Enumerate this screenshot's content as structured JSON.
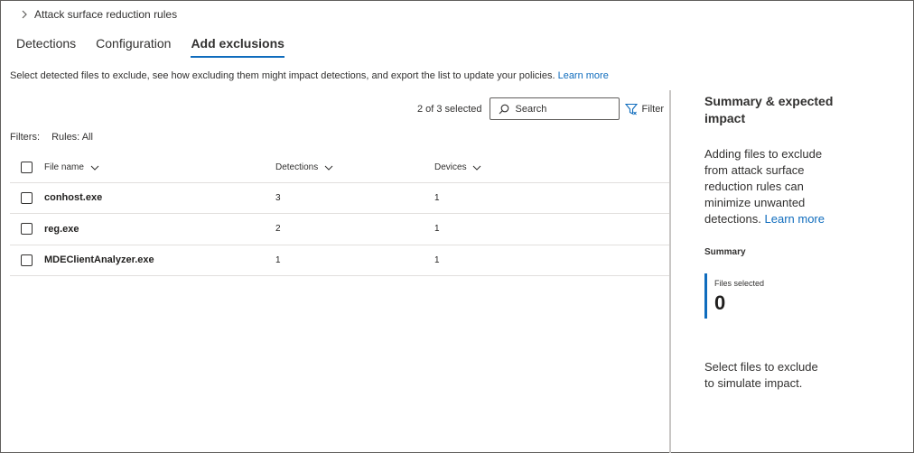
{
  "breadcrumb": {
    "label": "Attack surface reduction rules"
  },
  "tabs": [
    {
      "label": "Detections"
    },
    {
      "label": "Configuration"
    },
    {
      "label": "Add exclusions"
    }
  ],
  "description": {
    "text": "Select detected files to exclude, see how excluding them might impact detections, and export the list to update your policies.",
    "link": "Learn more"
  },
  "toolbar": {
    "selected_count": "2 of 3 selected",
    "search_placeholder": "Search",
    "filter_label": "Filter"
  },
  "filters": {
    "label": "Filters:",
    "value": "Rules: All"
  },
  "table": {
    "columns": [
      "File name",
      "Detections",
      "Devices"
    ],
    "rows": [
      {
        "name": "conhost.exe",
        "detections": "3",
        "devices": "1"
      },
      {
        "name": "reg.exe",
        "detections": "2",
        "devices": "1"
      },
      {
        "name": "MDEClientAnalyzer.exe",
        "detections": "1",
        "devices": "1"
      }
    ]
  },
  "panel": {
    "title": "Summary & expected impact",
    "body": "Adding files to exclude from attack surface reduction rules can minimize unwanted detections.",
    "body_link": "Learn more",
    "summary_heading": "Summary",
    "metric_label": "Files selected",
    "metric_value": "0",
    "footer": "Select files to exclude to simulate impact."
  },
  "colors": {
    "accent": "#0f6cbd",
    "divider": "#c8c6c4"
  },
  "icons": [
    "chevron-right-icon",
    "search-icon",
    "filter-icon",
    "chevron-down-icon"
  ]
}
